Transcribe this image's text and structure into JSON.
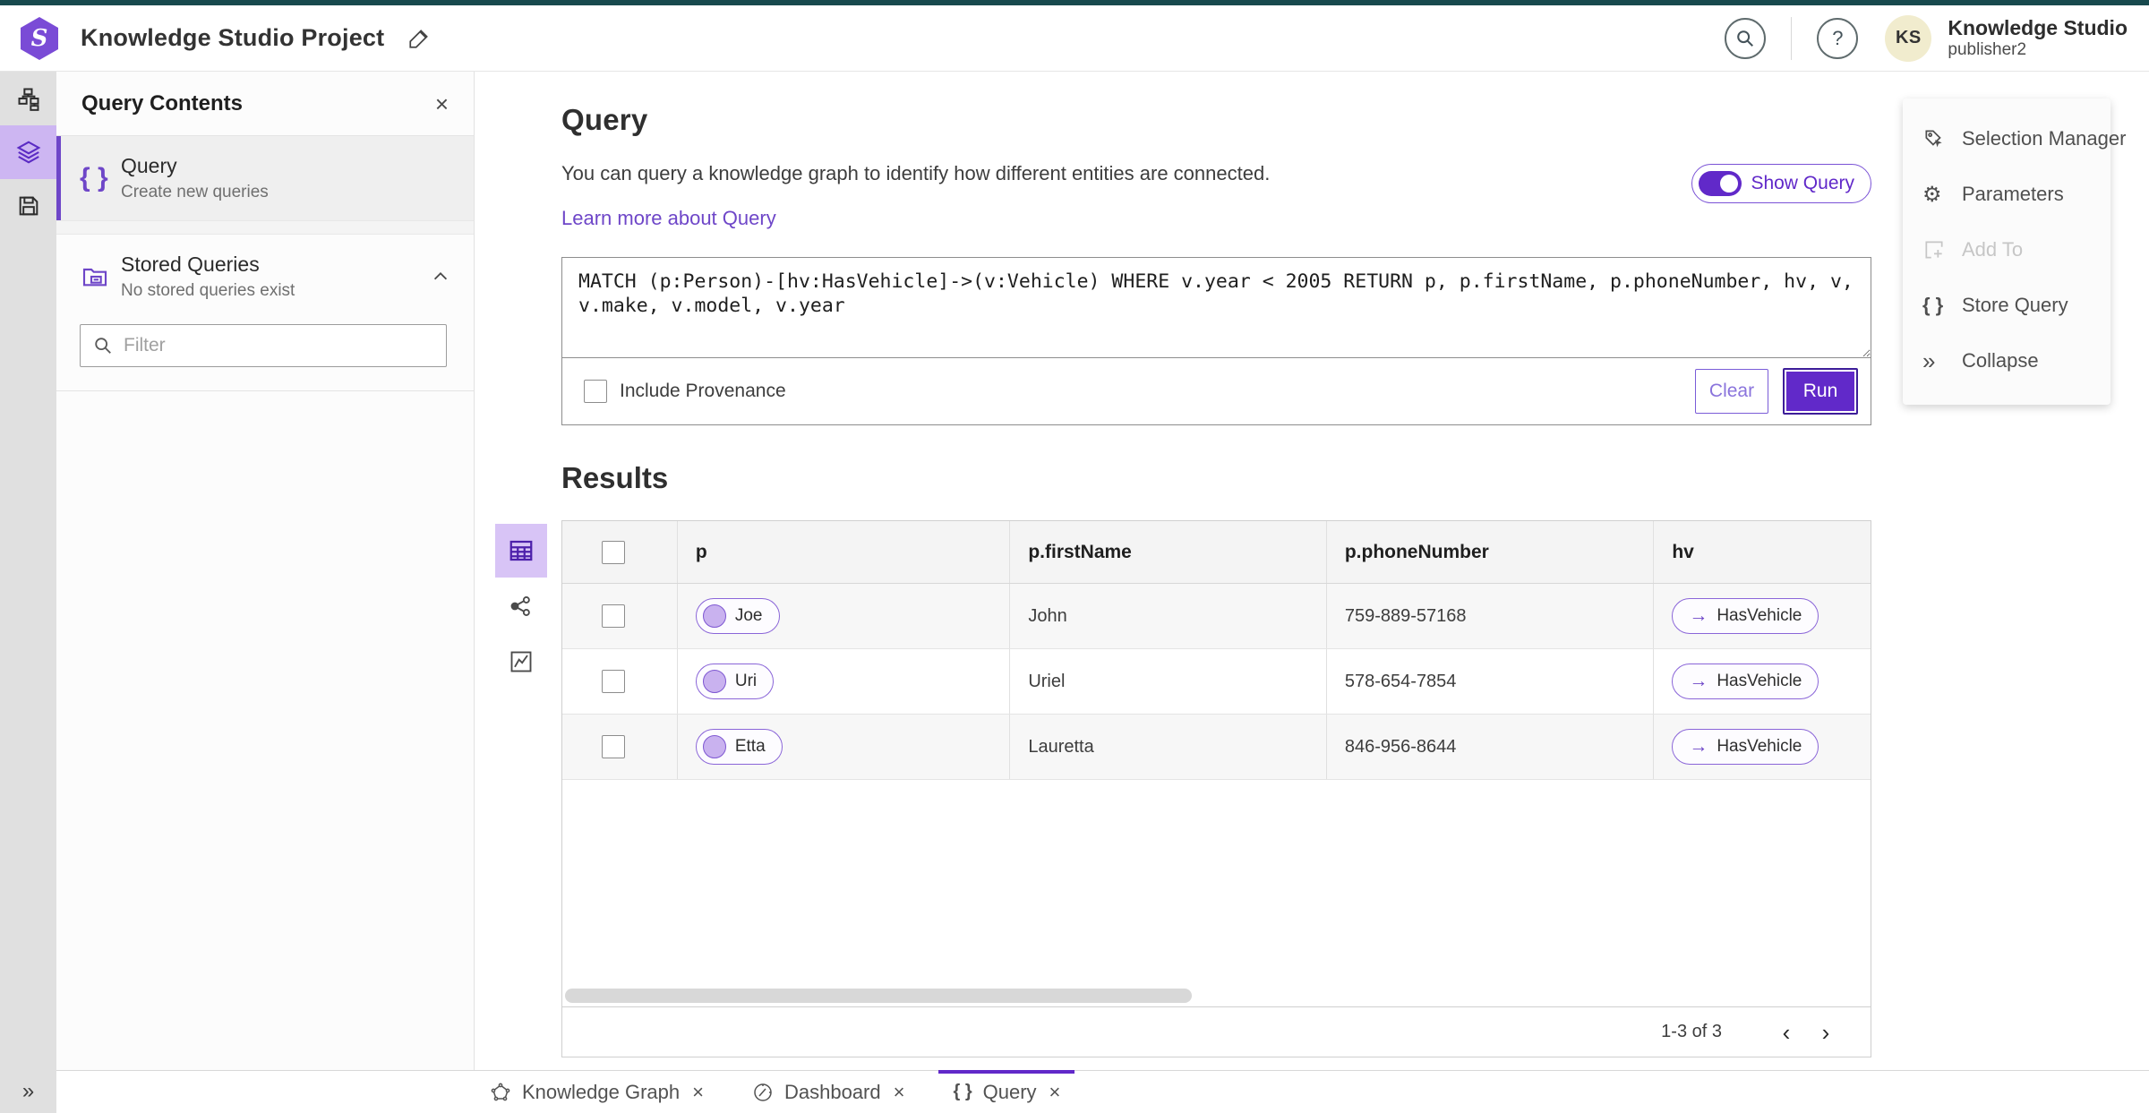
{
  "header": {
    "app_title": "Knowledge Studio Project",
    "user_initials": "KS",
    "user_name": "Knowledge Studio",
    "user_role": "publisher2"
  },
  "left_panel": {
    "title": "Query Contents",
    "query_item": {
      "label": "Query",
      "description": "Create new queries"
    },
    "stored_item": {
      "label": "Stored Queries",
      "description": "No stored queries exist"
    },
    "filter_placeholder": "Filter"
  },
  "query_section": {
    "title": "Query",
    "description": "You can query a knowledge graph to identify how different entities are connected.",
    "learn_more": "Learn more about Query",
    "show_query_label": "Show Query",
    "query_text": "MATCH (p:Person)-[hv:HasVehicle]->(v:Vehicle) WHERE v.year < 2005 RETURN p, p.firstName, p.phoneNumber, hv, v, v.make, v.model, v.year",
    "include_provenance_label": "Include Provenance",
    "clear_label": "Clear",
    "run_label": "Run"
  },
  "results": {
    "title": "Results",
    "columns": [
      "p",
      "p.firstName",
      "p.phoneNumber",
      "hv"
    ],
    "rows": [
      {
        "p": "Joe",
        "firstName": "John",
        "phoneNumber": "759-889-57168",
        "hv": "HasVehicle"
      },
      {
        "p": "Uri",
        "firstName": "Uriel",
        "phoneNumber": "578-654-7854",
        "hv": "HasVehicle"
      },
      {
        "p": "Etta",
        "firstName": "Lauretta",
        "phoneNumber": "846-956-8644",
        "hv": "HasVehicle"
      }
    ],
    "pagination": "1-3 of 3"
  },
  "right_menu": {
    "items": [
      {
        "label": "Selection Manager"
      },
      {
        "label": "Parameters"
      },
      {
        "label": "Add To"
      },
      {
        "label": "Store Query"
      },
      {
        "label": "Collapse"
      }
    ]
  },
  "bottom_tabs": [
    {
      "label": "Knowledge Graph"
    },
    {
      "label": "Dashboard"
    },
    {
      "label": "Query"
    }
  ],
  "icons": {
    "close": "×",
    "braces": "{ }",
    "double_chevron_right": "»",
    "arrow_right": "→",
    "prev": "‹",
    "next": "›",
    "help": "?",
    "gear": "⚙",
    "logo_letter": "S"
  },
  "colors": {
    "accent_purple": "#6129c9",
    "accent_purple_light": "#cdb6f2",
    "top_strip_teal": "#17494d",
    "avatar_bg": "#f1ecce"
  }
}
